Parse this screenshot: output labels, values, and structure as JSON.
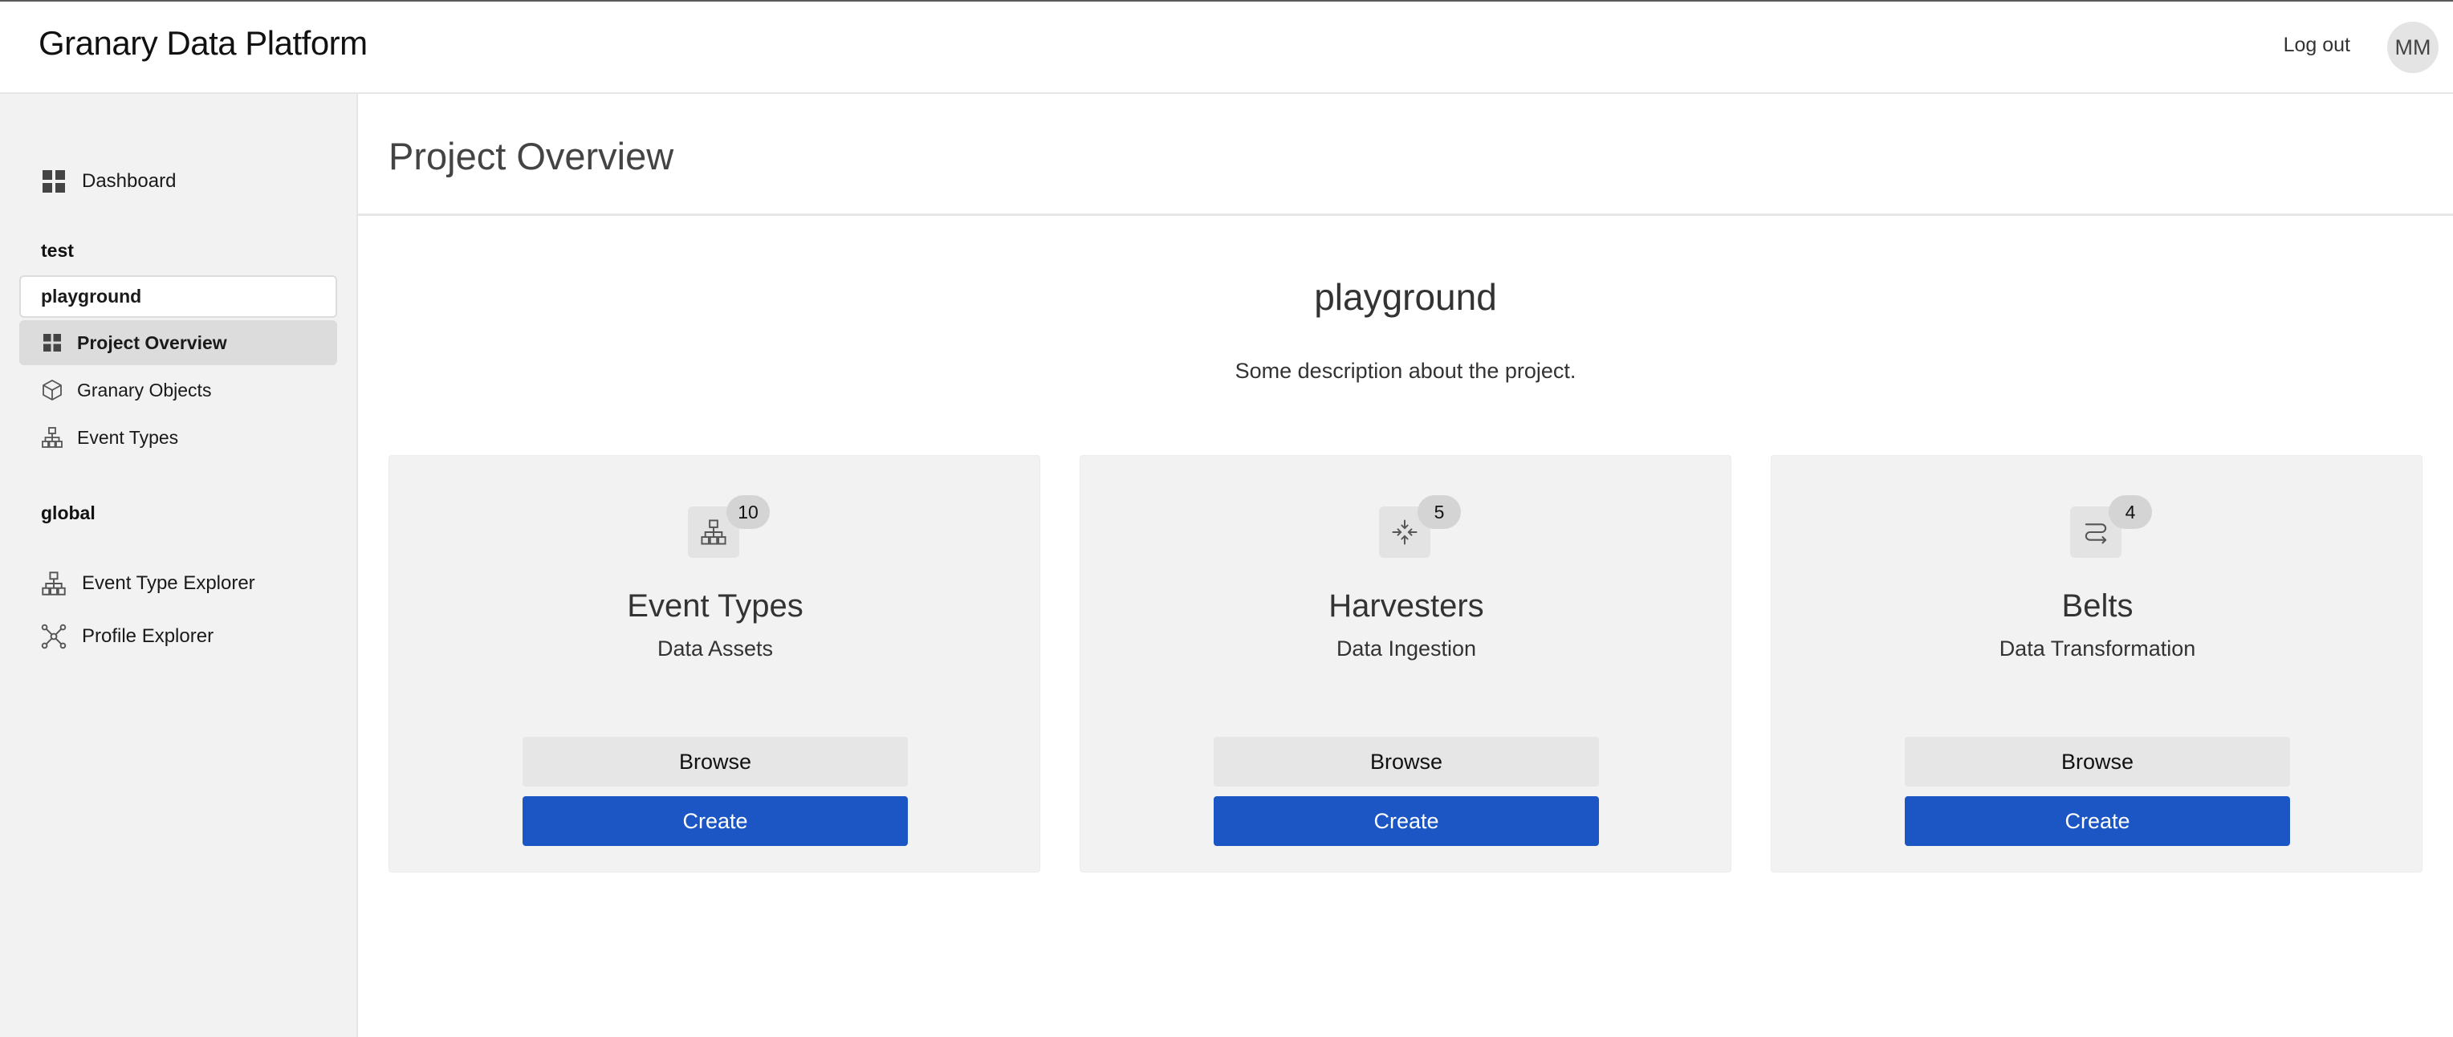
{
  "header": {
    "app_title": "Granary Data Platform",
    "logout_label": "Log out",
    "avatar_initials": "MM"
  },
  "sidebar": {
    "dashboard_label": "Dashboard",
    "group_test": "test",
    "project_selected": "playground",
    "project_items": [
      {
        "label": "Project Overview",
        "icon": "grid-icon",
        "active": true
      },
      {
        "label": "Granary Objects",
        "icon": "cube-icon"
      },
      {
        "label": "Event Types",
        "icon": "hierarchy-icon"
      }
    ],
    "group_global": "global",
    "global_items": [
      {
        "label": "Event Type Explorer",
        "icon": "hierarchy-icon"
      },
      {
        "label": "Profile Explorer",
        "icon": "network-icon"
      }
    ]
  },
  "main": {
    "page_title": "Project Overview",
    "project_name": "playground",
    "project_description": "Some description about the project.",
    "cards": [
      {
        "title": "Event Types",
        "subtitle": "Data Assets",
        "count": "10",
        "icon": "hierarchy-icon",
        "browse_label": "Browse",
        "create_label": "Create"
      },
      {
        "title": "Harvesters",
        "subtitle": "Data Ingestion",
        "count": "5",
        "icon": "collapse-arrows-icon",
        "browse_label": "Browse",
        "create_label": "Create"
      },
      {
        "title": "Belts",
        "subtitle": "Data Transformation",
        "count": "4",
        "icon": "route-icon",
        "browse_label": "Browse",
        "create_label": "Create"
      }
    ]
  },
  "colors": {
    "primary": "#1b56c4",
    "sidebar_bg": "#f2f2f2",
    "card_bg": "#f2f2f2"
  }
}
